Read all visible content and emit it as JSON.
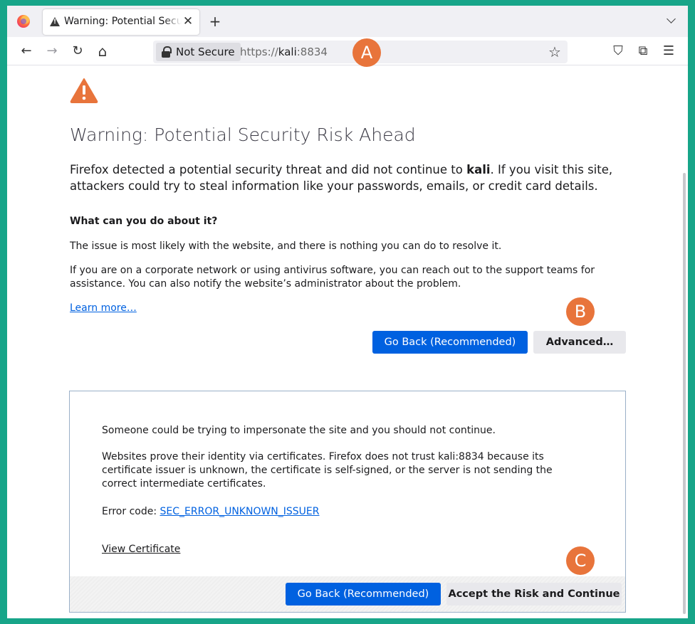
{
  "tab": {
    "title": "Warning: Potential Security Risk Ahead",
    "close": "✕"
  },
  "toolbar": {
    "new_tab": "+",
    "back": "←",
    "forward": "→",
    "reload": "↻",
    "home": "⌂",
    "not_secure": "Not Secure",
    "url_scheme": "https://",
    "url_host": "kali",
    "url_port": ":8834",
    "bookmark": "☆",
    "pocket": "⛉",
    "extensions": "⧉",
    "menu": "☰"
  },
  "markers": {
    "a": "A",
    "b": "B",
    "c": "C"
  },
  "page": {
    "title": "Warning: Potential Security Risk Ahead",
    "intro_before": "Firefox detected a potential security threat and did not continue to ",
    "intro_host": "kali",
    "intro_after": ". If you visit this site, attackers could try to steal information like your passwords, emails, or credit card details.",
    "what_heading": "What can you do about it?",
    "issue_text": "The issue is most likely with the website, and there is nothing you can do to resolve it.",
    "corporate_text": "If you are on a corporate network or using antivirus software, you can reach out to the support teams for assistance. You can also notify the website’s administrator about the problem.",
    "learn_more": "Learn more…",
    "go_back": "Go Back (Recommended)",
    "advanced": "Advanced…"
  },
  "advanced_panel": {
    "impersonate": "Someone could be trying to impersonate the site and you should not continue.",
    "certs_text": "Websites prove their identity via certificates. Firefox does not trust kali:8834 because its certificate issuer is unknown, the certificate is self-signed, or the server is not sending the correct intermediate certificates.",
    "error_label": "Error code: ",
    "error_code": "SEC_ERROR_UNKNOWN_ISSUER",
    "view_certificate": "View Certificate",
    "go_back": "Go Back (Recommended)",
    "accept": "Accept the Risk and Continue"
  },
  "colors": {
    "background": "#17a589",
    "marker": "#e8743b",
    "primary": "#0061e0",
    "warning": "#e8743b"
  },
  "icons": [
    "firefox-logo-icon",
    "warning-icon",
    "close-icon",
    "plus-icon",
    "chevron-down-icon",
    "back-arrow-icon",
    "forward-arrow-icon",
    "reload-icon",
    "home-icon",
    "lock-icon",
    "star-icon",
    "pocket-icon",
    "extensions-icon",
    "menu-icon"
  ]
}
